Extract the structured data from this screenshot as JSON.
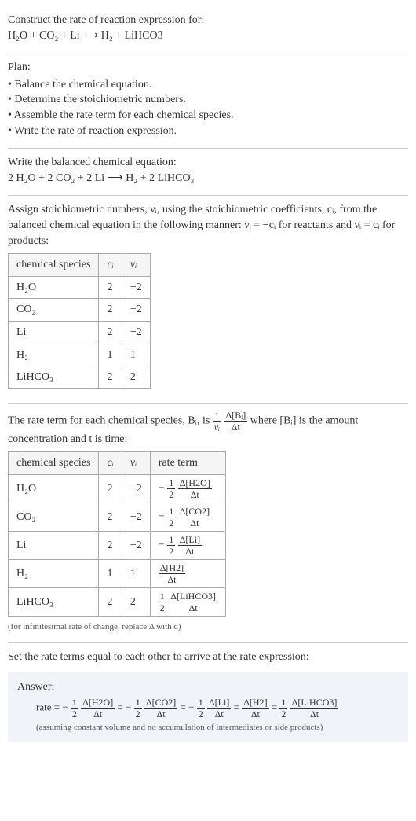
{
  "header": {
    "prompt": "Construct the rate of reaction expression for:",
    "equation": "H₂O + CO₂ + Li ⟶ H₂ + LiHCO3"
  },
  "plan": {
    "title": "Plan:",
    "items": [
      "Balance the chemical equation.",
      "Determine the stoichiometric numbers.",
      "Assemble the rate term for each chemical species.",
      "Write the rate of reaction expression."
    ]
  },
  "balanced": {
    "title": "Write the balanced chemical equation:",
    "equation": "2 H₂O + 2 CO₂ + 2 Li ⟶ H₂ + 2 LiHCO₃"
  },
  "stoich": {
    "intro_a": "Assign stoichiometric numbers, νᵢ, using the stoichiometric coefficients, cᵢ, from the balanced chemical equation in the following manner: νᵢ = −cᵢ for reactants and νᵢ = cᵢ for products:",
    "headers": {
      "species": "chemical species",
      "c": "cᵢ",
      "v": "νᵢ"
    },
    "rows": [
      {
        "species": "H₂O",
        "c": "2",
        "v": "−2"
      },
      {
        "species": "CO₂",
        "c": "2",
        "v": "−2"
      },
      {
        "species": "Li",
        "c": "2",
        "v": "−2"
      },
      {
        "species": "H₂",
        "c": "1",
        "v": "1"
      },
      {
        "species": "LiHCO₃",
        "c": "2",
        "v": "2"
      }
    ]
  },
  "rateterm": {
    "intro_pre": "The rate term for each chemical species, Bᵢ, is ",
    "intro_post": " where [Bᵢ] is the amount concentration and t is time:",
    "frac_outer": {
      "num": "1",
      "den": "νᵢ"
    },
    "frac_inner": {
      "num": "Δ[Bᵢ]",
      "den": "Δt"
    },
    "headers": {
      "species": "chemical species",
      "c": "cᵢ",
      "v": "νᵢ",
      "rate": "rate term"
    },
    "rows": [
      {
        "species": "H₂O",
        "c": "2",
        "v": "−2",
        "sign": "− ",
        "coef_num": "1",
        "coef_den": "2",
        "delta_num": "Δ[H2O]",
        "delta_den": "Δt"
      },
      {
        "species": "CO₂",
        "c": "2",
        "v": "−2",
        "sign": "− ",
        "coef_num": "1",
        "coef_den": "2",
        "delta_num": "Δ[CO2]",
        "delta_den": "Δt"
      },
      {
        "species": "Li",
        "c": "2",
        "v": "−2",
        "sign": "− ",
        "coef_num": "1",
        "coef_den": "2",
        "delta_num": "Δ[Li]",
        "delta_den": "Δt"
      },
      {
        "species": "H₂",
        "c": "1",
        "v": "1",
        "sign": "",
        "coef_num": "",
        "coef_den": "",
        "delta_num": "Δ[H2]",
        "delta_den": "Δt"
      },
      {
        "species": "LiHCO₃",
        "c": "2",
        "v": "2",
        "sign": "",
        "coef_num": "1",
        "coef_den": "2",
        "delta_num": "Δ[LiHCO3]",
        "delta_den": "Δt"
      }
    ],
    "note": "(for infinitesimal rate of change, replace Δ with d)"
  },
  "final": {
    "intro": "Set the rate terms equal to each other to arrive at the rate expression:",
    "answer_label": "Answer:",
    "lead": "rate = ",
    "terms": [
      {
        "sign": "− ",
        "coef_num": "1",
        "coef_den": "2",
        "delta_num": "Δ[H2O]",
        "delta_den": "Δt"
      },
      {
        "sign": "− ",
        "coef_num": "1",
        "coef_den": "2",
        "delta_num": "Δ[CO2]",
        "delta_den": "Δt"
      },
      {
        "sign": "− ",
        "coef_num": "1",
        "coef_den": "2",
        "delta_num": "Δ[Li]",
        "delta_den": "Δt"
      },
      {
        "sign": "",
        "coef_num": "",
        "coef_den": "",
        "delta_num": "Δ[H2]",
        "delta_den": "Δt"
      },
      {
        "sign": "",
        "coef_num": "1",
        "coef_den": "2",
        "delta_num": "Δ[LiHCO3]",
        "delta_den": "Δt"
      }
    ],
    "note": "(assuming constant volume and no accumulation of intermediates or side products)"
  }
}
